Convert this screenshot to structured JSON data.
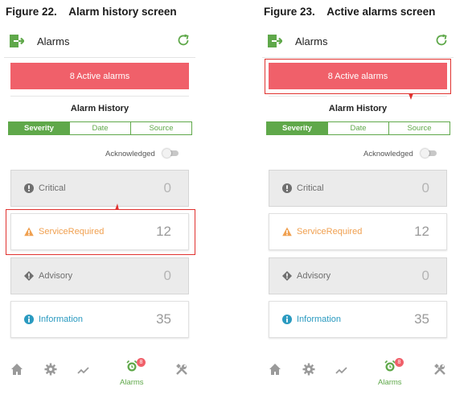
{
  "figures": [
    {
      "caption": "Figure 22.    Alarm history screen",
      "header": {
        "title": "Alarms"
      },
      "active_button_label": "8 Active alarms",
      "history_title": "Alarm History",
      "tabs": [
        {
          "label": "Severity"
        },
        {
          "label": "Date"
        },
        {
          "label": "Source"
        }
      ],
      "acknowledged_label": "Acknowledged",
      "acknowledged_on": false,
      "cards": [
        {
          "label": "Critical",
          "count": "0",
          "icon": "exclamation-circle-icon"
        },
        {
          "label": "ServiceRequired",
          "count": "12",
          "icon": "warning-triangle-icon"
        },
        {
          "label": "Advisory",
          "count": "0",
          "icon": "exclamation-diamond-icon"
        },
        {
          "label": "Information",
          "count": "35",
          "icon": "info-circle-icon"
        }
      ],
      "nav": {
        "alarms_label": "Alarms",
        "badge": "8"
      },
      "highlighted": "ServiceRequired"
    },
    {
      "caption": "Figure 23.    Active alarms screen",
      "header": {
        "title": "Alarms"
      },
      "active_button_label": "8 Active alarms",
      "history_title": "Alarm History",
      "tabs": [
        {
          "label": "Severity"
        },
        {
          "label": "Date"
        },
        {
          "label": "Source"
        }
      ],
      "acknowledged_label": "Acknowledged",
      "acknowledged_on": false,
      "cards": [
        {
          "label": "Critical",
          "count": "0",
          "icon": "exclamation-circle-icon"
        },
        {
          "label": "ServiceRequired",
          "count": "12",
          "icon": "warning-triangle-icon"
        },
        {
          "label": "Advisory",
          "count": "0",
          "icon": "exclamation-diamond-icon"
        },
        {
          "label": "Information",
          "count": "35",
          "icon": "info-circle-icon"
        }
      ],
      "nav": {
        "alarms_label": "Alarms",
        "badge": "8"
      },
      "highlighted": "8 Active alarms"
    }
  ],
  "colors": {
    "accent_green": "#5fa84a",
    "alarm_red": "#f0606a",
    "highlight_red": "#e0322f",
    "service_orange": "#f0a050",
    "info_blue": "#2a9ac0"
  }
}
